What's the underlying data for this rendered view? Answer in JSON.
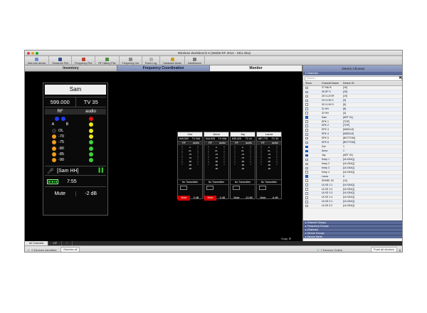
{
  "window": {
    "title": "Wireless Workbench 6 (Wwb6 RF 2012 - SD1.shw)"
  },
  "toolbar": [
    {
      "label": "Add new device",
      "color": "#6a8fcf"
    },
    {
      "label": "ShowLink Plot",
      "color": "#2c4a8f"
    },
    {
      "label": "Frequency Plot",
      "color": "#c04030"
    },
    {
      "label": "RF History Plot",
      "color": "#4a8f3a"
    },
    {
      "label": "Frequency List",
      "color": "#888888"
    },
    {
      "label": "Event Log",
      "color": "#b0b0b0"
    },
    {
      "label": "Hardware Alerts",
      "color": "#d09a20"
    },
    {
      "label": "Interference",
      "color": "#7a7a7a"
    }
  ],
  "tabs": [
    {
      "label": "Inventory",
      "state": "normal"
    },
    {
      "label": "Frequency Coordination",
      "state": "active"
    },
    {
      "label": "Monitor",
      "state": "selected"
    }
  ],
  "device": {
    "name": "Sam",
    "frequency": "599.000",
    "tv": "TV 35",
    "rf_header": "RF",
    "audio_header": "audio",
    "a_label": "A",
    "b_label": "B",
    "ol_label": "OL",
    "rf_levels": [
      "-70",
      "-75",
      "-80",
      "-85",
      "-90"
    ],
    "transmitter": "[Sam HH]",
    "battery_time": "7:55",
    "mute": "Mute",
    "gain": "-2 dB"
  },
  "minis": [
    {
      "name": "Zoe",
      "freq": "949.500",
      "tv": "TV N/A",
      "notx": "No Transmitter",
      "mute": "Mute",
      "gain": "0 dB",
      "muted": true
    },
    {
      "name": "Anna",
      "freq": "944.925",
      "tv": "TV N/A",
      "notx": "No Transmitter",
      "mute": "Mute",
      "gain": "0 dB",
      "muted": true
    },
    {
      "name": "Jay",
      "freq": "635.425",
      "tv": "TV 41",
      "notx": "No Transmitter",
      "mute": "Mute",
      "gain": "-13 dB",
      "muted": false
    },
    {
      "name": "Laura",
      "freq": "587.775",
      "tv": "TV 33",
      "notx": "No Transmitter",
      "mute": "Mute",
      "gain": "-6 dB",
      "muted": false
    }
  ],
  "mini_labels": {
    "rf": "RF",
    "audio": "audio",
    "a": "A",
    "b": "B",
    "ol": "OL",
    "levels": [
      "-70",
      "-75",
      "-80",
      "-85",
      "-90"
    ]
  },
  "snap_label": "Snap",
  "right_panel": {
    "title": "Device Chooser",
    "channels_section": "Channels",
    "search_placeholder": "Search...",
    "col_show": "Show",
    "col_name": "Channel Name",
    "col_id": "Device ID",
    "rows": [
      {
        "show": false,
        "name": "37 Mic B",
        "id": "[16]"
      },
      {
        "show": false,
        "name": "28 SP X",
        "id": "[25]"
      },
      {
        "show": false,
        "name": "28 X-LEVR",
        "id": "[19]"
      },
      {
        "show": false,
        "name": "29 X-HH C",
        "id": "[3]"
      },
      {
        "show": false,
        "name": "30 X-HH D",
        "id": "[6]"
      },
      {
        "show": false,
        "name": "31 HH",
        "id": "[8]"
      },
      {
        "show": false,
        "name": "32 HH",
        "id": "[4]"
      },
      {
        "show": true,
        "name": "Sam",
        "id": "[ART 01]"
      },
      {
        "show": false,
        "name": "SPK 1",
        "id": "[TOP]"
      },
      {
        "show": false,
        "name": "SPK 2",
        "id": "[TOP]"
      },
      {
        "show": false,
        "name": "SPK 3",
        "id": "[MIDDLE]"
      },
      {
        "show": false,
        "name": "SPK 4",
        "id": "[MIDDLE]"
      },
      {
        "show": false,
        "name": "SPK 5",
        "id": "[BOTTOM]"
      },
      {
        "show": false,
        "name": "SPK 6",
        "id": "[BOTTOM]"
      },
      {
        "show": true,
        "name": "Zoe",
        "id": "1"
      },
      {
        "show": true,
        "name": "Anna",
        "id": "1"
      },
      {
        "show": true,
        "name": "Jay",
        "id": "[ART 01]"
      },
      {
        "show": false,
        "name": "Keep 1",
        "id": "[ULXD4Q]"
      },
      {
        "show": false,
        "name": "Keep 2",
        "id": "[ULXD4Q]"
      },
      {
        "show": false,
        "name": "Keep 3",
        "id": "[ULXD4Q]"
      },
      {
        "show": false,
        "name": "Keep 4",
        "id": "[ULXD4Q]"
      },
      {
        "show": true,
        "name": "Laura",
        "id": "6"
      },
      {
        "show": false,
        "name": "SPARE XX",
        "id": "[12]"
      },
      {
        "show": false,
        "name": "ULXD 1:1",
        "id": "[ULXD4Q]"
      },
      {
        "show": false,
        "name": "ULXD 1:2",
        "id": "[ULXD4Q]"
      },
      {
        "show": false,
        "name": "ULXD 1:3",
        "id": "[ULXD4Q]"
      },
      {
        "show": false,
        "name": "ULXD 1:4",
        "id": "[ULXD4Q]"
      },
      {
        "show": false,
        "name": "ULXD 2:1",
        "id": "[ULXD4Q]"
      },
      {
        "show": false,
        "name": "ULXD 2:2",
        "id": "[ULXD4Q]"
      }
    ],
    "bottom_sections": [
      "Channel Groups",
      "Frequency Groups",
      "Channels",
      "Device Groups",
      "Device Alerts"
    ]
  },
  "subtabs": [
    "All Channels",
    "VIP"
  ],
  "status": {
    "identified": "0 Devices Identified",
    "dismiss": "Dismiss all",
    "online": "7 Devices Online",
    "push": "Push all devices"
  }
}
